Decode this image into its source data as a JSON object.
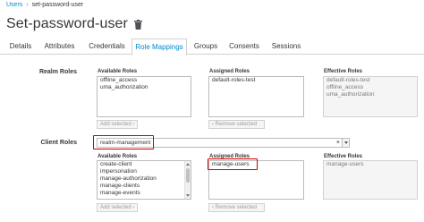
{
  "breadcrumb": {
    "parent": "Users",
    "separator": "›",
    "current": "set-password-user"
  },
  "page": {
    "title": "Set-password-user",
    "delete_icon": "trash-icon"
  },
  "tabs": [
    {
      "label": "Details"
    },
    {
      "label": "Attributes"
    },
    {
      "label": "Credentials"
    },
    {
      "label": "Role Mappings",
      "active": true
    },
    {
      "label": "Groups"
    },
    {
      "label": "Consents"
    },
    {
      "label": "Sessions"
    }
  ],
  "realm_roles": {
    "label": "Realm Roles",
    "available_title": "Available Roles",
    "available": [
      "offline_access",
      "uma_authorization"
    ],
    "add_button": "Add selected ›",
    "assigned_title": "Assigned Roles",
    "assigned": [
      "default-roles-test"
    ],
    "remove_button": "‹ Remove selected",
    "effective_title": "Effective Roles",
    "effective": [
      "default-roles-test",
      "offline_access",
      "uma_authorization"
    ]
  },
  "client_roles": {
    "label": "Client Roles",
    "client_select": {
      "value": "realm-management",
      "clear": "×"
    },
    "available_title": "Available Roles",
    "available": [
      "create-client",
      "impersonation",
      "manage-authorization",
      "manage-clients",
      "manage-events"
    ],
    "add_button": "Add selected ›",
    "assigned_title": "Assigned Roles",
    "assigned": [
      "manage-users"
    ],
    "remove_button": "‹ Remove selected",
    "effective_title": "Effective Roles",
    "effective": [
      "manage-users"
    ]
  },
  "colors": {
    "link": "#0088ce",
    "highlight": "#cc0000"
  }
}
